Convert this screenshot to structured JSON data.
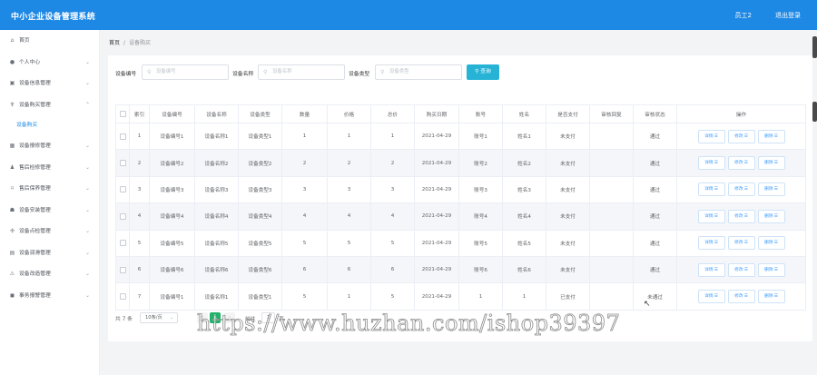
{
  "header": {
    "title": "中小企业设备管理系统",
    "user": "员工2",
    "logout": "退出登录"
  },
  "sidebar": {
    "items": [
      {
        "label": "首页",
        "icon": "home-icon",
        "glyph": "⌂",
        "chevron": ""
      },
      {
        "label": "个人中心",
        "icon": "user-icon",
        "glyph": "●",
        "chevron": "⌄"
      },
      {
        "label": "设备信息管理",
        "icon": "info-icon",
        "glyph": "▣",
        "chevron": "⌄"
      },
      {
        "label": "设备购买管理",
        "icon": "cart-icon",
        "glyph": "♆",
        "chevron": "⌃"
      },
      {
        "label": "设备报修管理",
        "icon": "repair-icon",
        "glyph": "▦",
        "chevron": "⌄"
      },
      {
        "label": "售后检修管理",
        "icon": "person-icon",
        "glyph": "♟",
        "chevron": "⌄"
      },
      {
        "label": "售后保养管理",
        "icon": "maintain-icon",
        "glyph": "⌑",
        "chevron": "⌄"
      },
      {
        "label": "设备安装管理",
        "icon": "install-icon",
        "glyph": "☗",
        "chevron": "⌄"
      },
      {
        "label": "设备点检管理",
        "icon": "check-icon",
        "glyph": "✣",
        "chevron": "⌄"
      },
      {
        "label": "设备润滑管理",
        "icon": "lubricate-icon",
        "glyph": "▤",
        "chevron": "⌄"
      },
      {
        "label": "设备改造管理",
        "icon": "modify-icon",
        "glyph": "⚠",
        "chevron": "⌄"
      },
      {
        "label": "事务报警管理",
        "icon": "alarm-icon",
        "glyph": "◼",
        "chevron": "⌄"
      }
    ],
    "active_sub": "设备购买"
  },
  "breadcrumb": {
    "home": "首页",
    "separator": "/",
    "current": "设备购买"
  },
  "search": {
    "fields": [
      {
        "label": "设备编号",
        "placeholder": "设备编号"
      },
      {
        "label": "设备名称",
        "placeholder": "设备名称"
      },
      {
        "label": "设备类型",
        "placeholder": "设备类型"
      }
    ],
    "query_button": "查询"
  },
  "table": {
    "headers": [
      "",
      "索引",
      "设备编号",
      "设备名称",
      "设备类型",
      "数量",
      "价格",
      "总价",
      "购买日期",
      "账号",
      "姓名",
      "是否支付",
      "审核回复",
      "审核状态",
      "操作"
    ],
    "rows": [
      [
        "1",
        "设备编号1",
        "设备名称1",
        "设备类型1",
        "1",
        "1",
        "1",
        "2021-04-29",
        "账号1",
        "姓名1",
        "未支付",
        "",
        "通过"
      ],
      [
        "2",
        "设备编号2",
        "设备名称2",
        "设备类型2",
        "2",
        "2",
        "2",
        "2021-04-29",
        "账号2",
        "姓名2",
        "未支付",
        "",
        "通过"
      ],
      [
        "3",
        "设备编号3",
        "设备名称3",
        "设备类型3",
        "3",
        "3",
        "3",
        "2021-04-29",
        "账号3",
        "姓名3",
        "未支付",
        "",
        "通过"
      ],
      [
        "4",
        "设备编号4",
        "设备名称4",
        "设备类型4",
        "4",
        "4",
        "4",
        "2021-04-29",
        "账号4",
        "姓名4",
        "未支付",
        "",
        "通过"
      ],
      [
        "5",
        "设备编号5",
        "设备名称5",
        "设备类型5",
        "5",
        "5",
        "5",
        "2021-04-29",
        "账号5",
        "姓名5",
        "未支付",
        "",
        "通过"
      ],
      [
        "6",
        "设备编号6",
        "设备名称6",
        "设备类型6",
        "6",
        "6",
        "6",
        "2021-04-29",
        "账号6",
        "姓名6",
        "未支付",
        "",
        "通过"
      ],
      [
        "7",
        "设备编号1",
        "设备名称1",
        "设备类型1",
        "5",
        "1",
        "5",
        "2021-04-29",
        "1",
        "1",
        "已支付",
        "",
        "未通过"
      ]
    ],
    "actions": [
      {
        "label": "详情",
        "glyph": "☰"
      },
      {
        "label": "修改",
        "glyph": "☰"
      },
      {
        "label": "删除",
        "glyph": "☰"
      }
    ]
  },
  "pagination": {
    "total": "共 7 条",
    "page_size": "10条/页",
    "prev": "‹",
    "current_page": "1",
    "next": "›",
    "goto_label": "前往",
    "goto_value": "1",
    "page_unit": "页"
  },
  "watermark": "https://www.huzhan.com/ishop39397",
  "colors": {
    "header": "#1e88e5",
    "query_button": "#26b3d6",
    "active_page": "#21b36b",
    "link": "#409eff"
  }
}
